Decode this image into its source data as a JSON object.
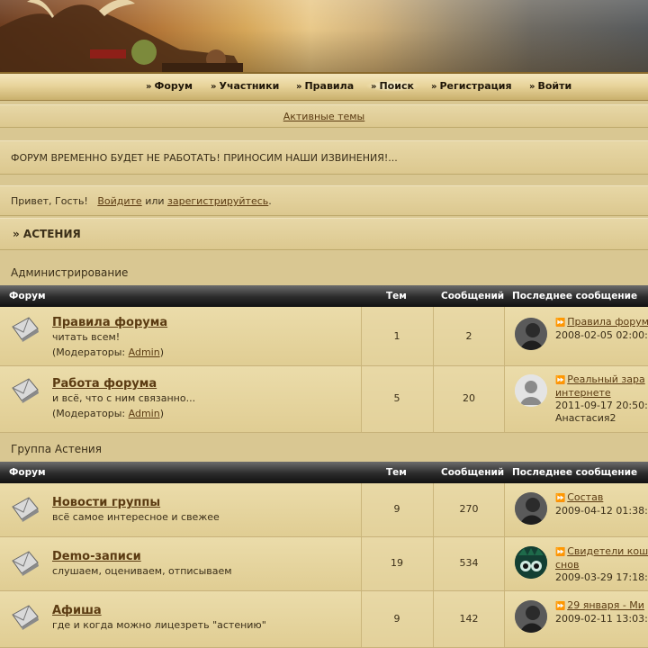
{
  "nav": {
    "items": [
      {
        "label": "Форум"
      },
      {
        "label": "Участники"
      },
      {
        "label": "Правила"
      },
      {
        "label": "Поиск"
      },
      {
        "label": "Регистрация"
      },
      {
        "label": "Войти"
      }
    ]
  },
  "active_topics": "Активные темы",
  "announcement": "ФОРУМ ВРЕМЕННО БУДЕТ НЕ РАБОТАТЬ! ПРИНОСИМ НАШИ ИЗВИНЕНИЯ!...",
  "greeting": {
    "prefix": "Привет, Гость!",
    "login": "Войдите",
    "or": "или",
    "register": "зарегистрируйтесь",
    "suffix": "."
  },
  "breadcrumb": "» АСТЕНИЯ",
  "table_headers": {
    "forum": "Форум",
    "topics": "Тем",
    "posts": "Сообщений",
    "last": "Последнее сообщение"
  },
  "moderators_label": "(Модераторы: ",
  "moderators_close": ")",
  "categories": [
    {
      "name": "Администрирование",
      "forums": [
        {
          "title": "Правила форума",
          "desc": "читать всем!",
          "moderator": "Admin",
          "topics": "1",
          "posts": "2",
          "last_title": "Правила форум",
          "last_date": "2008-02-05 02:00:",
          "last_user": ""
        },
        {
          "title": "Работа форума",
          "desc": "и всё, что с ним связанно...",
          "moderator": "Admin",
          "topics": "5",
          "posts": "20",
          "last_title": "Реальный зара",
          "last_title2": "интернете",
          "last_date": "2011-09-17 20:50:",
          "last_user": "Анастасия2"
        }
      ]
    },
    {
      "name": "Группа Астения",
      "forums": [
        {
          "title": "Новости группы",
          "desc": "всё самое интересное и свежее",
          "topics": "9",
          "posts": "270",
          "last_title": "Состав",
          "last_date": "2009-04-12 01:38:"
        },
        {
          "title": "Demo-записи",
          "desc": "слушаем, оцениваем, отписываем",
          "topics": "19",
          "posts": "534",
          "last_title": "Свидетели кош",
          "last_title2": "снов",
          "last_date": "2009-03-29 17:18:"
        },
        {
          "title": "Афиша",
          "desc": "где и когда можно лицезреть \"астению\"",
          "topics": "9",
          "posts": "142",
          "last_title": "29 января - Ми",
          "last_date": "2009-02-11 13:03:"
        }
      ]
    }
  ]
}
